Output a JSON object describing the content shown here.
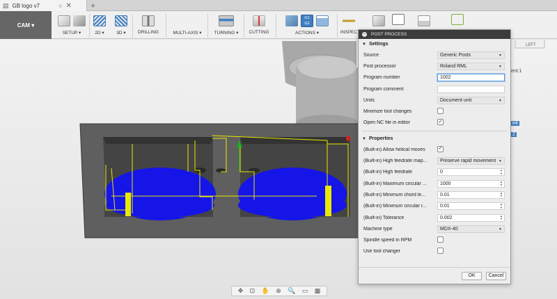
{
  "tab": {
    "title": "GB logo v7"
  },
  "toolbar": {
    "workspace": "CAM ▾",
    "groups": [
      {
        "label": "SETUP ▾"
      },
      {
        "label": "2D ▾"
      },
      {
        "label": "3D ▾"
      },
      {
        "label": "DRILLING"
      },
      {
        "label": "MULTI-AXIS ▾"
      },
      {
        "label": "TURNING ▾"
      },
      {
        "label": "CUTTING"
      },
      {
        "label": "ACTIONS ▾"
      },
      {
        "label": "INSPEC"
      }
    ],
    "g1g2": "G1\nG2"
  },
  "browser_partial": {
    "text1": "ent:1",
    "text2": "e4",
    "text3": "2"
  },
  "viewcube": {
    "label": "LEFT"
  },
  "dialog": {
    "title": "POST PROCESS",
    "settings": {
      "heading": "Settings",
      "source_label": "Source",
      "source_value": "Generic Posts",
      "post_label": "Post processor",
      "post_value": "Roland RML",
      "program_number_label": "Program number",
      "program_number_value": "1002",
      "program_comment_label": "Program comment",
      "program_comment_value": "",
      "units_label": "Units",
      "units_value": "Document unit",
      "minimize_label": "Minimize tool changes",
      "minimize_checked": false,
      "open_nc_label": "Open NC file in editor",
      "open_nc_checked": true
    },
    "properties": {
      "heading": "Properties",
      "rows": [
        {
          "label": "(Built-in) Allow helical moves",
          "type": "checkbox",
          "checked": true
        },
        {
          "label": "(Built-in) High feedrate map...",
          "type": "select",
          "value": "Preserve rapid movement"
        },
        {
          "label": "(Built-in) High feedrate",
          "type": "number",
          "value": "0"
        },
        {
          "label": "(Built-in) Maximum circular ...",
          "type": "number",
          "value": "1000"
        },
        {
          "label": "(Built-in) Minimum chord le...",
          "type": "number",
          "value": "0.01"
        },
        {
          "label": "(Built-in) Minimum circular r...",
          "type": "number",
          "value": "0.01"
        },
        {
          "label": "(Built-in) Tolerance",
          "type": "number",
          "value": "0.002"
        },
        {
          "label": "Machine type",
          "type": "select",
          "value": "MDX-40"
        },
        {
          "label": "Spindle speed in RPM",
          "type": "checkbox",
          "checked": false
        },
        {
          "label": "Use tool changer",
          "type": "checkbox",
          "checked": false
        }
      ]
    },
    "ok_label": "OK",
    "cancel_label": "Cancel"
  },
  "icons": [
    "document-icon",
    "cloud-icon",
    "close-icon",
    "new-tab-icon",
    "check-icon"
  ],
  "colors": {
    "pocket_blue": "#1515e8",
    "toolpath_yellow": "#e8e800",
    "stock_gray": "#5f5f5f",
    "header_dark": "#3c3c3c",
    "focus_blue": "#5c9bd8"
  }
}
